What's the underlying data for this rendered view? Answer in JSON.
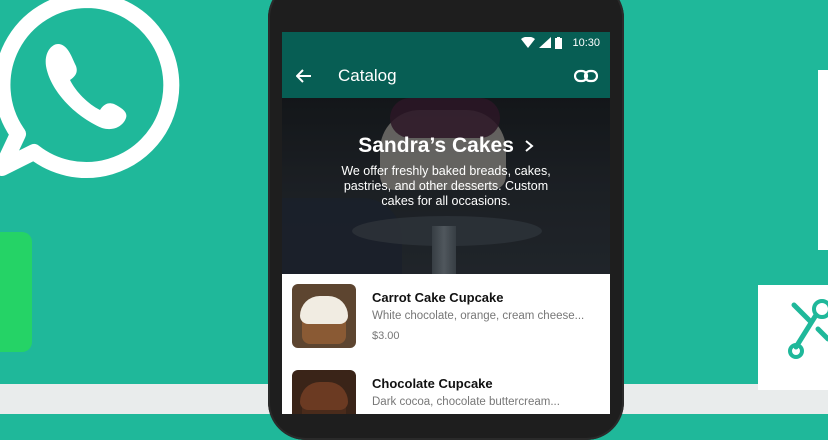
{
  "status_bar": {
    "time": "10:30"
  },
  "app_bar": {
    "title": "Catalog"
  },
  "business": {
    "name": "Sandra’s Cakes",
    "description": "We offer freshly baked breads, cakes, pastries, and other desserts. Custom cakes for all occasions."
  },
  "items": [
    {
      "name": "Carrot Cake Cupcake",
      "subtitle": "White chocolate, orange, cream cheese...",
      "price": "$3.00"
    },
    {
      "name": "Chocolate Cupcake",
      "subtitle": "Dark cocoa, chocolate buttercream...",
      "price": ""
    }
  ],
  "colors": {
    "background": "#1fb89a",
    "app_bar": "#075e54",
    "accent_green": "#25d366"
  }
}
